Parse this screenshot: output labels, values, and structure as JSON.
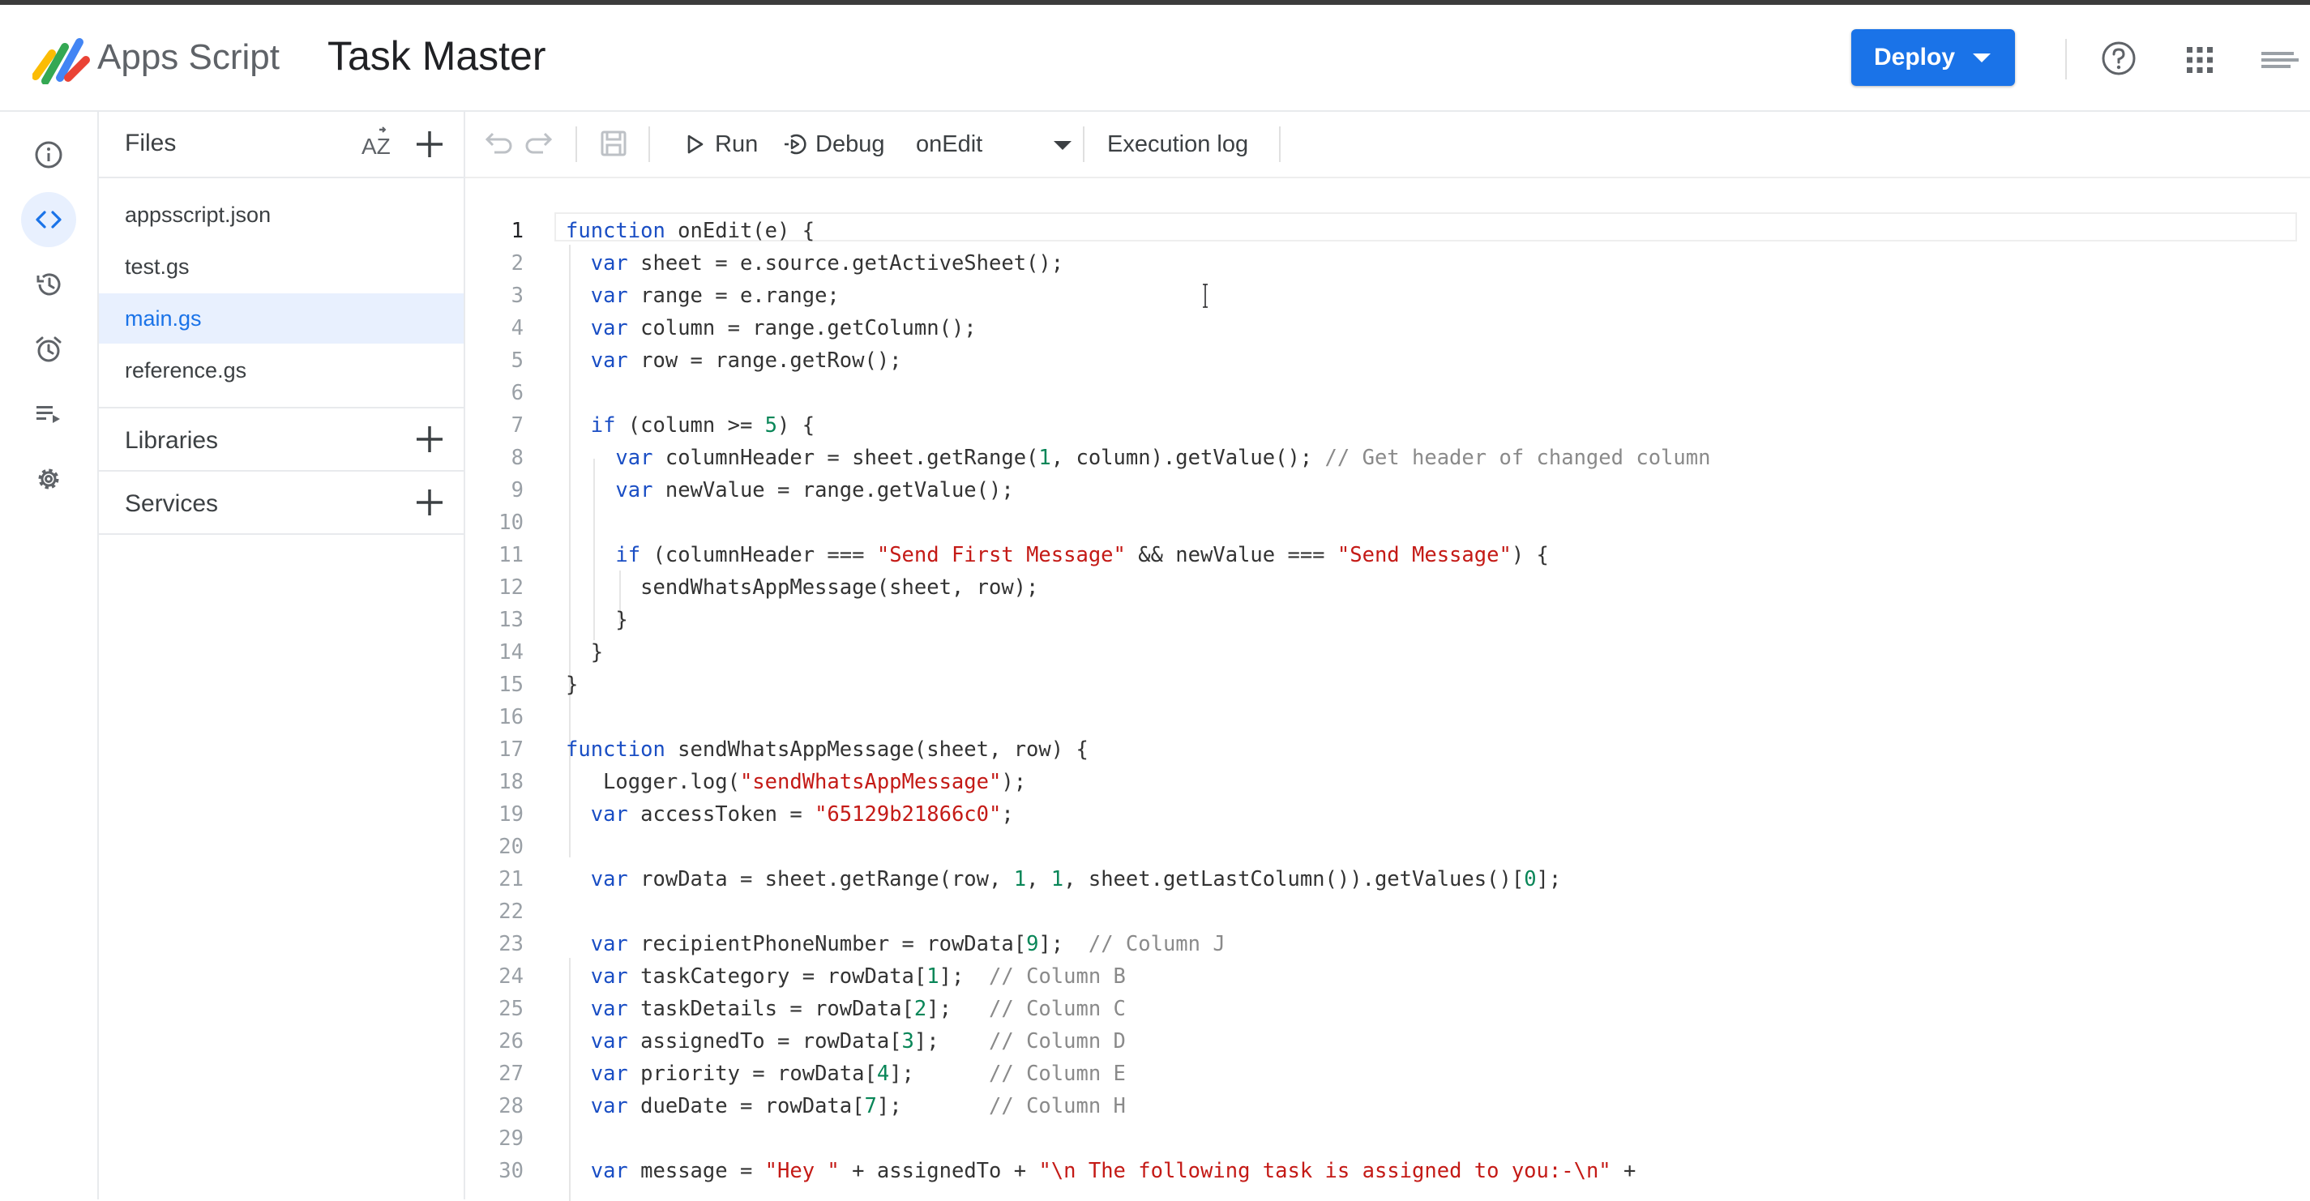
{
  "header": {
    "app_name": "Apps Script",
    "project_title": "Task Master",
    "deploy_label": "Deploy",
    "accent_color": "#1a73e8",
    "icons": [
      "apps-script-logo",
      "help-icon",
      "google-apps-icon",
      "account-icon"
    ]
  },
  "rail": {
    "items": [
      "overview-icon",
      "editor-icon",
      "history-icon",
      "triggers-icon",
      "executions-icon",
      "settings-icon"
    ],
    "active": "editor-icon"
  },
  "files": {
    "title": "Files",
    "items": [
      {
        "label": "appsscript.json"
      },
      {
        "label": "test.gs"
      },
      {
        "label": "main.gs"
      },
      {
        "label": "reference.gs"
      }
    ],
    "active_file": "main.gs",
    "libraries_label": "Libraries",
    "services_label": "Services"
  },
  "toolbar": {
    "run_label": "Run",
    "debug_label": "Debug",
    "function_name": "onEdit",
    "execution_log_label": "Execution log"
  },
  "editor": {
    "current_line": "1",
    "lines": [
      {
        "n": "1",
        "t": "function onEdit(e) {"
      },
      {
        "n": "2",
        "t": "  var sheet = e.source.getActiveSheet();"
      },
      {
        "n": "3",
        "t": "  var range = e.range;"
      },
      {
        "n": "4",
        "t": "  var column = range.getColumn();"
      },
      {
        "n": "5",
        "t": "  var row = range.getRow();"
      },
      {
        "n": "6",
        "t": ""
      },
      {
        "n": "7",
        "t": "  if (column >= 5) {"
      },
      {
        "n": "8",
        "t": "    var columnHeader = sheet.getRange(1, column).getValue(); // Get header of changed column"
      },
      {
        "n": "9",
        "t": "    var newValue = range.getValue();"
      },
      {
        "n": "10",
        "t": ""
      },
      {
        "n": "11",
        "t": "    if (columnHeader === \"Send First Message\" && newValue === \"Send Message\") {"
      },
      {
        "n": "12",
        "t": "      sendWhatsAppMessage(sheet, row);"
      },
      {
        "n": "13",
        "t": "    }"
      },
      {
        "n": "14",
        "t": "  }"
      },
      {
        "n": "15",
        "t": "}"
      },
      {
        "n": "16",
        "t": ""
      },
      {
        "n": "17",
        "t": "function sendWhatsAppMessage(sheet, row) {"
      },
      {
        "n": "18",
        "t": "   Logger.log(\"sendWhatsAppMessage\");"
      },
      {
        "n": "19",
        "t": "  var accessToken = \"65129b21866c0\";"
      },
      {
        "n": "20",
        "t": ""
      },
      {
        "n": "21",
        "t": "  var rowData = sheet.getRange(row, 1, 1, sheet.getLastColumn()).getValues()[0];"
      },
      {
        "n": "22",
        "t": ""
      },
      {
        "n": "23",
        "t": "  var recipientPhoneNumber = rowData[9];  // Column J"
      },
      {
        "n": "24",
        "t": "  var taskCategory = rowData[1];  // Column B"
      },
      {
        "n": "25",
        "t": "  var taskDetails = rowData[2];   // Column C"
      },
      {
        "n": "26",
        "t": "  var assignedTo = rowData[3];    // Column D"
      },
      {
        "n": "27",
        "t": "  var priority = rowData[4];      // Column E"
      },
      {
        "n": "28",
        "t": "  var dueDate = rowData[7];       // Column H"
      },
      {
        "n": "29",
        "t": ""
      },
      {
        "n": "30",
        "t": "  var message = \"Hey \" + assignedTo + \"\\n The following task is assigned to you:-\\n\" +"
      }
    ]
  }
}
